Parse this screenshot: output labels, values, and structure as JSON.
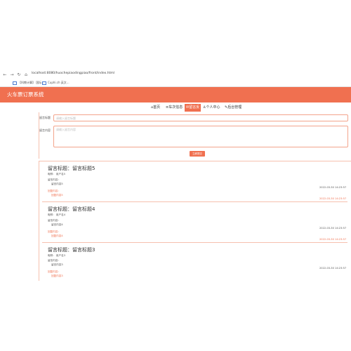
{
  "browser": {
    "url": "localhost:8080/huochepiaodingpiao/front/index.html",
    "bookmarks": [
      "【科教计算】 国际...",
      "Cuphi.ch 英文...",
      "Graphic UN 图工行..."
    ]
  },
  "header": {
    "title": "火车票订票系统"
  },
  "nav": [
    {
      "label": "⌂首页"
    },
    {
      "label": "≡车次信息"
    },
    {
      "label": "✉留言反"
    },
    {
      "label": "♙个人中心"
    },
    {
      "label": "✎后台管理"
    }
  ],
  "form": {
    "title_label": "留言标题",
    "title_placeholder": "请输入留言标题",
    "content_label": "留言内容",
    "content_placeholder": "请输入留言内容",
    "submit_label": "立即提交"
  },
  "messages": [
    {
      "title": "留言标题：留言标题5",
      "user": "昵称：  用户名5",
      "content_label": "留言内容：",
      "content": "留言内容5",
      "reply_label": "回复内容：",
      "reply": "回复内容5",
      "date1": "2022-03-30 14:23:57",
      "date2": "2022-03-30 14:23:57"
    },
    {
      "title": "留言标题：留言标题4",
      "user": "昵称：  用户名4",
      "content_label": "留言内容：",
      "content": "留言内容4",
      "reply_label": "回复内容：",
      "reply": "回复内容4",
      "date1": "2022-03-30 14:23:57",
      "date2": "2022-03-30 14:23:57"
    },
    {
      "title": "留言标题：留言标题3",
      "user": "昵称：  用户名3",
      "content_label": "留言内容：",
      "content": "留言内容3",
      "reply_label": "回复内容：",
      "reply": "回复内容3",
      "date1": "2022-03-30 14:23:57",
      "date2": ""
    }
  ]
}
